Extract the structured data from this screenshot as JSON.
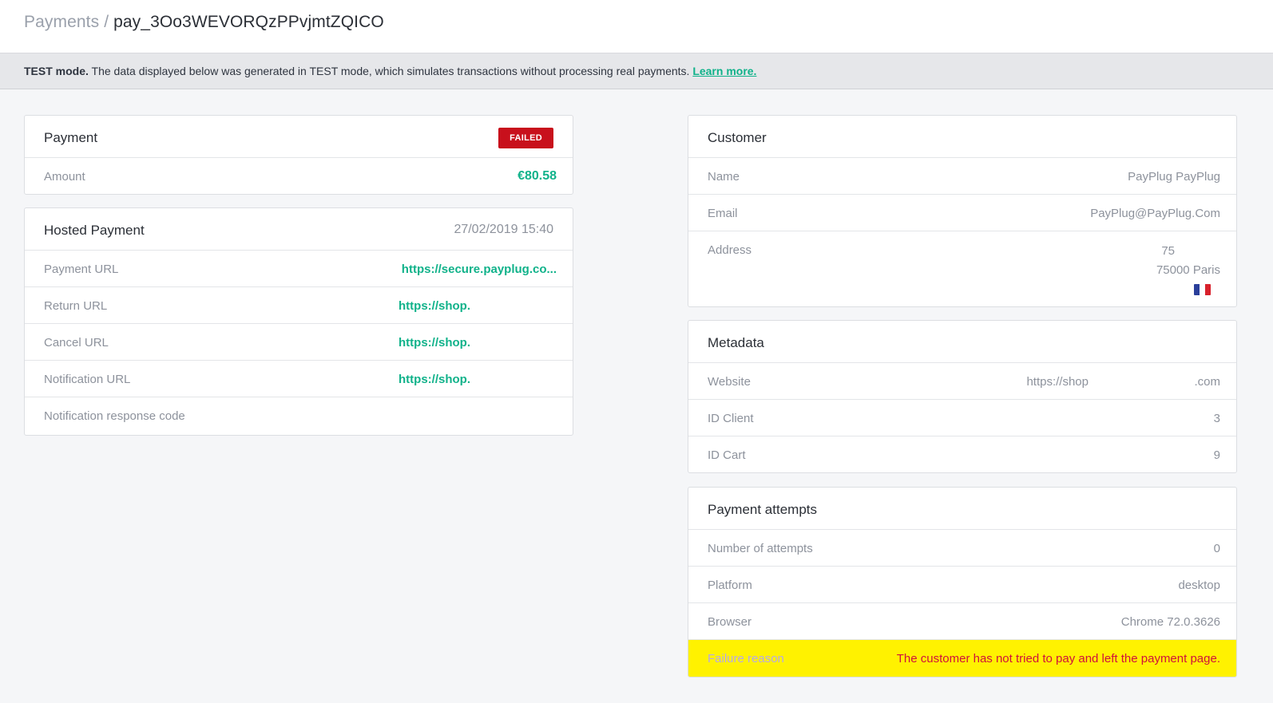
{
  "breadcrumb": {
    "parent": "Payments",
    "separator": "/",
    "current": "pay_3Oo3WEVORQzPPvjmtZQICO"
  },
  "banner": {
    "mode_label": "TEST mode.",
    "message": " The data displayed below was generated in TEST mode, which simulates transactions without processing real payments. ",
    "link_label": "Learn more."
  },
  "payment": {
    "title": "Payment",
    "status": "FAILED",
    "amount_label": "Amount",
    "amount": "€80.58"
  },
  "hosted_payment": {
    "title": "Hosted Payment",
    "date": "27/02/2019 15:40",
    "rows": [
      {
        "label": "Payment URL",
        "value": "https://secure.payplug.co..."
      },
      {
        "label": "Return URL",
        "value": "https://shop."
      },
      {
        "label": "Cancel URL",
        "value": "https://shop."
      },
      {
        "label": "Notification URL",
        "value": "https://shop."
      },
      {
        "label": "Notification response code",
        "value": ""
      }
    ]
  },
  "customer": {
    "title": "Customer",
    "name_label": "Name",
    "name": "PayPlug PayPlug",
    "email_label": "Email",
    "email": "PayPlug@PayPlug.Com",
    "address_label": "Address",
    "address_line1": "75",
    "address_line2": "75000 Paris",
    "country_flag_icon": "france-flag-icon"
  },
  "metadata": {
    "title": "Metadata",
    "website_label": "Website",
    "website_prefix": "https://shop",
    "website_suffix": ".com",
    "id_client_label": "ID Client",
    "id_client": "3",
    "id_cart_label": "ID Cart",
    "id_cart": "9"
  },
  "attempts": {
    "title": "Payment attempts",
    "count_label": "Number of attempts",
    "count": "0",
    "platform_label": "Platform",
    "platform": "desktop",
    "browser_label": "Browser",
    "browser": "Chrome 72.0.3626",
    "failure_label": "Failure reason",
    "failure": "The customer has not tried to pay and left the payment page."
  },
  "colors": {
    "accent_green": "#10b28a",
    "failed_red": "#c8101c",
    "highlight_yellow": "#fff200"
  }
}
